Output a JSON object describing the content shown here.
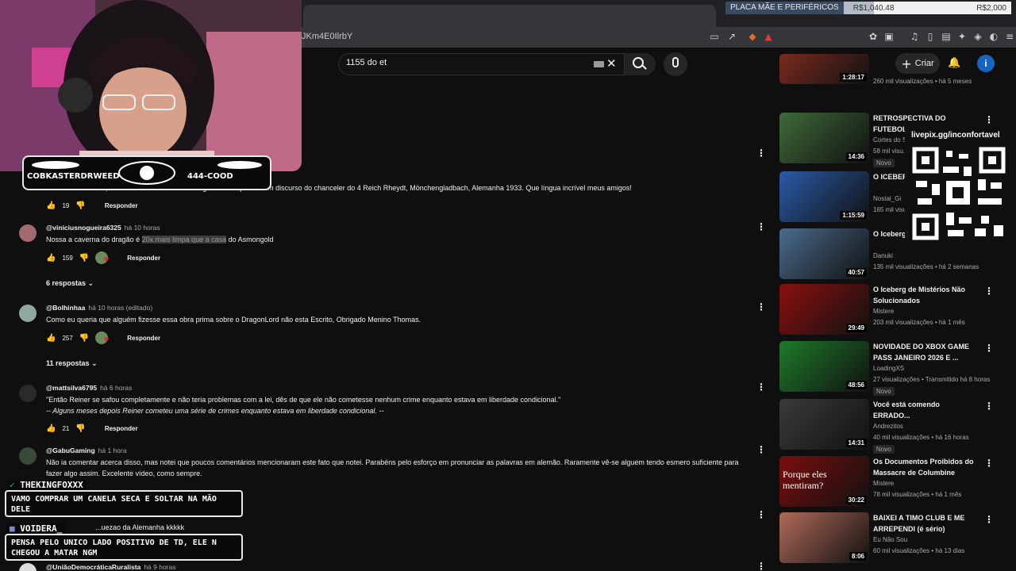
{
  "browser": {
    "url_fragment": "JKm4E0IlrbY"
  },
  "ticker": {
    "product": "PLACA MÃE E PERIFÉRICOS",
    "current": "R$1,040.48",
    "goal": "R$2,000",
    "progress_fraction": 0.52
  },
  "header": {
    "search_value": "1155 do et",
    "create_label": "Criar",
    "avatar_letter": "i"
  },
  "comments": [
    {
      "text": "Meu Deus kkkkkkk, ele está falando alemão e xingando mas parece um discurso do chanceler do 4 Reich Rheydt, Mönchengladbach, Alemanha 1933. Que língua incrível meus amigos!",
      "likes": "19",
      "reply_label": "Responder"
    },
    {
      "author": "@viniciusnogueira6325",
      "time": "há 10 horas",
      "text_before": "Nossa a caverna do dragão é ",
      "text_highlight": "20x mais limpa que a casa",
      "text_after": " do Asmongold",
      "likes": "159",
      "reply_label": "Responder",
      "replies_label": "6 respostas"
    },
    {
      "author": "@Bolhinhaa",
      "time": "há 10 horas (editado)",
      "text": "Como eu queria que alguém fizesse essa obra prima sobre o DragonLord não esta Escrito, Obrigado Menino Thomas.",
      "likes": "257",
      "reply_label": "Responder",
      "replies_label": "11 respostas"
    },
    {
      "author": "@mattsilva6795",
      "time": "há 6 horas",
      "text": "\"Então Reiner se safou completamente e não teria problemas com a lei, dês de que ele não cometesse nenhum crime enquanto estava em liberdade condicional.\"",
      "text2": "-- Alguns meses depois Reiner cometeu uma série de crimes enquanto estava em liberdade condicional. --",
      "likes": "21",
      "reply_label": "Responder"
    },
    {
      "author": "@GabuGaming",
      "time": "há 1 hora",
      "text": "Não ia comentar acerca disso, mas notei que poucos comentários mencionaram este fato que notei. Parabéns pelo esforço em pronunciar as palavras em alemão. Raramente vê-se alguem tendo esmero suficiente para",
      "text2": "fazer algo assim. Excelente vídeo, como sempre."
    },
    {
      "text": "...uezao da Alemanha kkkkk"
    },
    {
      "author": "@UniãoDemocráticaRuralista",
      "time": "há 9 horas"
    }
  ],
  "videos": [
    {
      "title": "",
      "channel": "",
      "stats": "260 mil visualizações • há 5 meses",
      "duration": "1:28:17",
      "color": "#7a2a1e"
    },
    {
      "title": "RETROSPECTIVA DO FUTEBOL 2025 | RE...",
      "channel": "Cortes do S...",
      "stats": "58 mil visu...",
      "duration": "14:36",
      "badge": "Novo",
      "color": "#3f6a3a"
    },
    {
      "title": "O ICEBER... BRASILEI...",
      "channel": "Nostal_Gi",
      "stats": "165 mil visu...",
      "duration": "1:15:59",
      "color": "#2a5aa8"
    },
    {
      "title": "O Iceberg... Pesquisa...",
      "channel": "Danuki",
      "stats": "135 mil visualizações • há 2 semanas",
      "duration": "40:57",
      "color": "#4a6b8c"
    },
    {
      "title": "O Iceberg de Mistérios Não Solucionados",
      "channel": "Mistere",
      "stats": "203 mil visualizações • há 1 mês",
      "duration": "29:49",
      "color": "#8a1010"
    },
    {
      "title": "NOVIDADE DO XBOX GAME PASS JANEIRO 2026 E ...",
      "channel": "LoadingXS",
      "stats": "27 visualizações • Transmitido há 8 horas",
      "duration": "48:56",
      "badge": "Novo",
      "color": "#1d7a2a"
    },
    {
      "title": "Você está comendo ERRADO...",
      "channel": "Andrezitos",
      "stats": "40 mil visualizações • há 16 horas",
      "duration": "14:31",
      "badge": "Novo",
      "color": "#3a3a3a"
    },
    {
      "title": "Os Documentos Proibidos do Massacre de Columbine",
      "channel": "Mistere",
      "stats": "78 mil visualizações • há 1 mês",
      "duration": "30:22",
      "thumb_text": "Porque eles mentiram?",
      "color": "#7a0d0d"
    },
    {
      "title": "BAIXEI A TIMO CLUB E ME ARREPENDI (é sério)",
      "channel": "Eu Não Sou",
      "stats": "60 mil visualizações • há 13 dias",
      "duration": "8:06",
      "color": "#b06a5a"
    }
  ],
  "overlay": {
    "streamer_name": "COBKASTERDRWEED",
    "phone": "444-COOD",
    "qr_url": "livepix.gg/inconfortavel",
    "chat": [
      {
        "user": "THEKINGFOXXX",
        "message": "VAMO COMPRAR UM CANELA SECA E SOLTAR NA MÃO DELE"
      },
      {
        "user": "VOIDERA_",
        "message": "PENSA PELO UNICO LADO POSITIVO DE TD, ELE N CHEGOU A MATAR NGM"
      }
    ]
  }
}
